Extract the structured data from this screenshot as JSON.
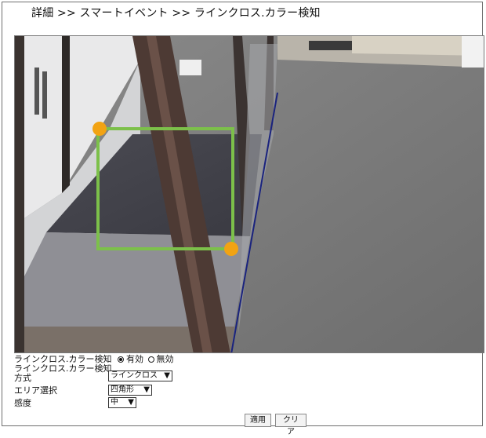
{
  "breadcrumb": "詳細 >> スマートイベント >> ラインクロス.カラー検知",
  "form": {
    "detect_label": "ラインクロス.カラー検知",
    "enable_label": "有効",
    "disable_label": "無効",
    "mode_label_1": "ラインクロス.カラー検知",
    "mode_label_2": "方式",
    "mode_value": "ラインクロス",
    "area_label": "エリア選択",
    "area_value": "四角形",
    "sensitivity_label": "感度",
    "sensitivity_value": "中",
    "apply_label": "適用",
    "clear_label": "クリア"
  },
  "overlay": {
    "region_color": "#7cc04a",
    "handle_color": "#f2a313",
    "line_color": "#1a237e"
  },
  "icons": [
    "chevron-down-icon",
    "radio-icon"
  ]
}
